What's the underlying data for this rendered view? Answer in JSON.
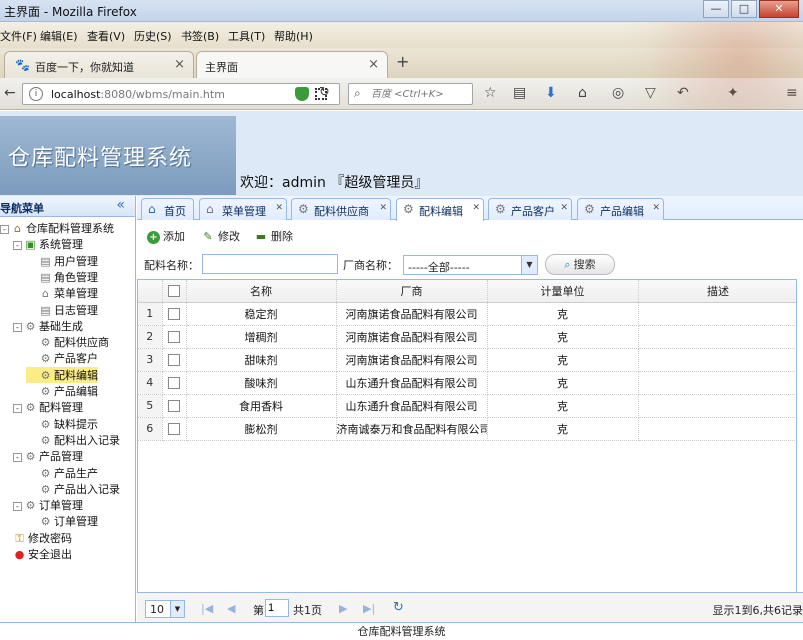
{
  "window": {
    "title": "主界面 - Mozilla Firefox"
  },
  "menubar": [
    "文件(F)",
    "编辑(E)",
    "查看(V)",
    "历史(S)",
    "书签(B)",
    "工具(T)",
    "帮助(H)"
  ],
  "browser_tabs": [
    {
      "label": "百度一下，你就知道"
    },
    {
      "label": "主界面"
    }
  ],
  "url": {
    "host": "localhost",
    "path": ":8080/wbms/main.htm"
  },
  "browser_search": {
    "placeholder": "百度 <Ctrl+K>"
  },
  "app": {
    "title": "仓库配料管理系统",
    "welcome": "欢迎：admin 『超级管理员』",
    "footer": "仓库配料管理系统"
  },
  "sidebar": {
    "title": "导航菜单",
    "tree": [
      {
        "label": "仓库配料管理系统",
        "level": 0,
        "icon": "home-icon",
        "expander": "-"
      },
      {
        "label": "系统管理",
        "level": 1,
        "icon": "system-icon",
        "expander": "-"
      },
      {
        "label": "用户管理",
        "level": 2,
        "icon": "document-icon"
      },
      {
        "label": "角色管理",
        "level": 2,
        "icon": "document-icon"
      },
      {
        "label": "菜单管理",
        "level": 2,
        "icon": "menu-icon"
      },
      {
        "label": "日志管理",
        "level": 2,
        "icon": "document-icon"
      },
      {
        "label": "基础生成",
        "level": 1,
        "icon": "gear-icon",
        "expander": "-"
      },
      {
        "label": "配料供应商",
        "level": 2,
        "icon": "gear-icon"
      },
      {
        "label": "产品客户",
        "level": 2,
        "icon": "gear-icon"
      },
      {
        "label": "配料编辑",
        "level": 2,
        "icon": "gear-icon",
        "selected": true
      },
      {
        "label": "产品编辑",
        "level": 2,
        "icon": "gear-icon"
      },
      {
        "label": "配料管理",
        "level": 1,
        "icon": "gear-icon",
        "expander": "-"
      },
      {
        "label": "缺料提示",
        "level": 2,
        "icon": "gear-icon"
      },
      {
        "label": "配料出入记录",
        "level": 2,
        "icon": "gear-icon"
      },
      {
        "label": "产品管理",
        "level": 1,
        "icon": "gear-icon",
        "expander": "-"
      },
      {
        "label": "产品生产",
        "level": 2,
        "icon": "gear-icon"
      },
      {
        "label": "产品出入记录",
        "level": 2,
        "icon": "gear-icon"
      },
      {
        "label": "订单管理",
        "level": 1,
        "icon": "gear-icon",
        "expander": "-"
      },
      {
        "label": "订单管理",
        "level": 2,
        "icon": "gear-icon"
      },
      {
        "label": "修改密码",
        "level": 1,
        "icon": "key-icon"
      },
      {
        "label": "安全退出",
        "level": 1,
        "icon": "exit-icon"
      }
    ]
  },
  "content_tabs": [
    {
      "label": "首页",
      "icon": "home-icon",
      "closable": false
    },
    {
      "label": "菜单管理",
      "icon": "menu-icon",
      "closable": true
    },
    {
      "label": "配料供应商",
      "icon": "gear-icon",
      "closable": true
    },
    {
      "label": "配料编辑",
      "icon": "gear-icon",
      "closable": true,
      "active": true
    },
    {
      "label": "产品客户",
      "icon": "gear-icon",
      "closable": true
    },
    {
      "label": "产品编辑",
      "icon": "gear-icon",
      "closable": true
    }
  ],
  "toolbar": {
    "add": "添加",
    "edit": "修改",
    "delete": "删除"
  },
  "search": {
    "name_label": "配料名称：",
    "name_value": "",
    "vendor_label": "厂商名称：",
    "vendor_selected": "-----全部-----",
    "button": "搜索"
  },
  "table": {
    "columns": [
      "名称",
      "厂商",
      "计量单位",
      "描述"
    ],
    "rows": [
      [
        "稳定剂",
        "河南旗诺食品配料有限公司",
        "克",
        ""
      ],
      [
        "增稠剂",
        "河南旗诺食品配料有限公司",
        "克",
        ""
      ],
      [
        "甜味剂",
        "河南旗诺食品配料有限公司",
        "克",
        ""
      ],
      [
        "酸味剂",
        "山东通升食品配料有限公司",
        "克",
        ""
      ],
      [
        "食用香料",
        "山东通升食品配料有限公司",
        "克",
        ""
      ],
      [
        "膨松剂",
        "济南诚泰万和食品配料有限公司",
        "克",
        ""
      ]
    ]
  },
  "pager": {
    "page_size": "10",
    "page_label": "第",
    "page_number": "1",
    "total_label": "共1页",
    "info": "显示1到6,共6记录"
  }
}
